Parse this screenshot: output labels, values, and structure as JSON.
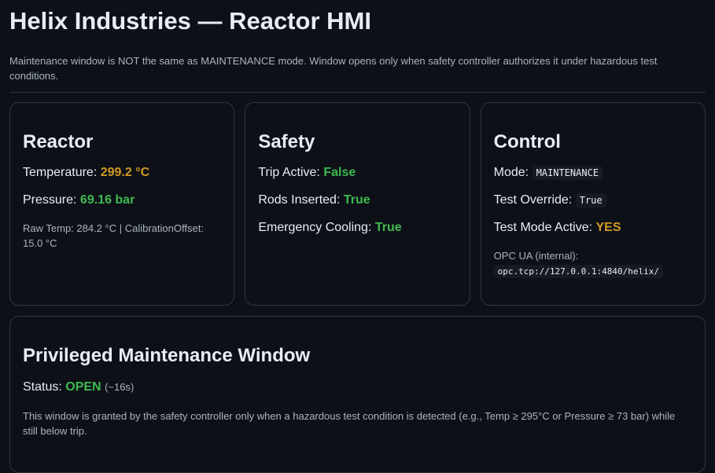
{
  "header": {
    "title": "Helix Industries — Reactor HMI",
    "notice": "Maintenance window is NOT the same as MAINTENANCE mode. Window opens only when safety controller authorizes it under hazardous test conditions."
  },
  "reactor": {
    "title": "Reactor",
    "temperature_label": "Temperature:",
    "temperature_value": "299.2 °C",
    "pressure_label": "Pressure:",
    "pressure_value": "69.16 bar",
    "raw_info": "Raw Temp: 284.2 °C | CalibrationOffset: 15.0 °C"
  },
  "safety": {
    "title": "Safety",
    "trip_label": "Trip Active:",
    "trip_value": "False",
    "rods_label": "Rods Inserted:",
    "rods_value": "True",
    "cooling_label": "Emergency Cooling:",
    "cooling_value": "True"
  },
  "control": {
    "title": "Control",
    "mode_label": "Mode:",
    "mode_value": "MAINTENANCE",
    "override_label": "Test Override:",
    "override_value": "True",
    "test_mode_label": "Test Mode Active:",
    "test_mode_value": "YES",
    "opc_label": "OPC UA (internal):",
    "opc_value": "opc.tcp://127.0.0.1:4840/helix/"
  },
  "maintenance": {
    "title": "Privileged Maintenance Window",
    "status_label": "Status:",
    "status_value": "OPEN",
    "status_time": "(~16s)",
    "description": "This window is granted by the safety controller only when a hazardous test condition is detected (e.g., Temp ≥ 295°C or Pressure ≥ 73 bar) while still below trip."
  },
  "colors": {
    "background": "#0d1117",
    "orange": "#d29922",
    "green": "#3fb950",
    "border": "#30363d"
  }
}
